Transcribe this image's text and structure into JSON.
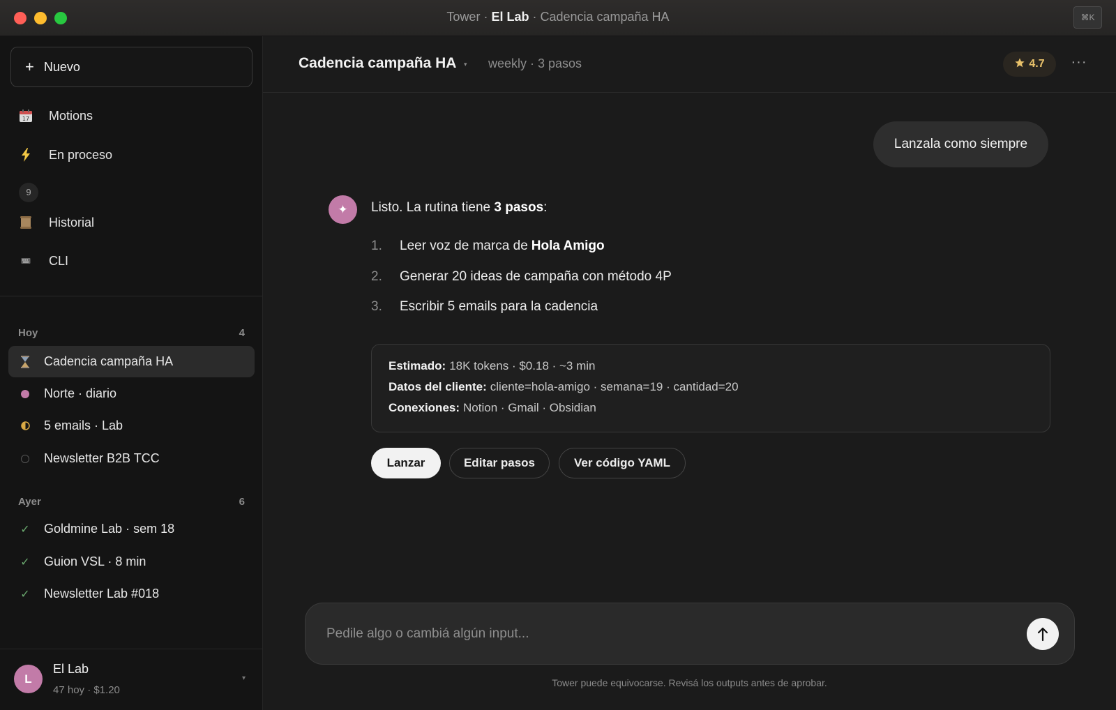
{
  "window": {
    "title_prefix": "Tower · ",
    "title_strong": "El Lab",
    "title_suffix": " · Cadencia campaña HA",
    "shortcut": "⌘K"
  },
  "sidebar": {
    "new_label": "Nuevo",
    "nav": [
      {
        "icon": "calendar-icon",
        "label": "Motions"
      },
      {
        "icon": "lightning-icon",
        "label": "En proceso",
        "badge": "9"
      },
      {
        "icon": "scroll-icon",
        "label": "Historial"
      },
      {
        "icon": "keyboard-icon",
        "label": "CLI"
      }
    ],
    "sections": [
      {
        "title": "Hoy",
        "count": "4",
        "items": [
          {
            "icon": "hourglass-icon",
            "label": "Cadencia campaña HA",
            "active": true
          },
          {
            "icon": "pink-dot-icon",
            "label": "Norte · diario"
          },
          {
            "icon": "half-circle-icon",
            "label": "5 emails · Lab"
          },
          {
            "icon": "empty-circle-icon",
            "label": "Newsletter B2B TCC"
          }
        ]
      },
      {
        "title": "Ayer",
        "count": "6",
        "items": [
          {
            "icon": "check-icon",
            "label": "Goldmine Lab · sem 18"
          },
          {
            "icon": "check-icon",
            "label": "Guion VSL · 8 min"
          },
          {
            "icon": "check-icon",
            "label": "Newsletter Lab #018"
          }
        ]
      }
    ],
    "user": {
      "initial": "L",
      "name": "El Lab",
      "meta": "47 hoy · $1.20"
    }
  },
  "header": {
    "title": "Cadencia campaña HA",
    "meta": "weekly · 3 pasos",
    "rating": "4.7"
  },
  "chat": {
    "user_message": "Lanzala como siempre",
    "ai": {
      "avatar_glyph": "✦",
      "lead_a": "Listo. La rutina tiene ",
      "lead_b": "3 pasos",
      "lead_c": ":",
      "steps": [
        {
          "n": "1.",
          "text": "Leer voz de marca de",
          "bold": "Hola Amigo"
        },
        {
          "n": "2.",
          "text": "Generar 20 ideas de campaña con método 4P",
          "bold": ""
        },
        {
          "n": "3.",
          "text": "Escribir 5 emails para la cadencia",
          "bold": ""
        }
      ],
      "estimate": [
        {
          "label": "Estimado:",
          "value": "18K tokens · $0.18 · ~3 min"
        },
        {
          "label": "Datos del cliente:",
          "value": "cliente=hola-amigo · semana=19 · cantidad=20"
        },
        {
          "label": "Conexiones:",
          "value": "Notion · Gmail · Obsidian"
        }
      ],
      "actions": {
        "launch": "Lanzar",
        "edit": "Editar pasos",
        "yaml": "Ver código YAML"
      }
    }
  },
  "composer": {
    "placeholder": "Pedile algo o cambiá algún input..."
  },
  "disclaimer": "Tower puede equivocarse. Revisá los outputs antes de aprobar.",
  "colors": {
    "accent_pink": "#c27ba8",
    "rating_gold": "#e8c16a",
    "check_green": "#6aa86e"
  }
}
